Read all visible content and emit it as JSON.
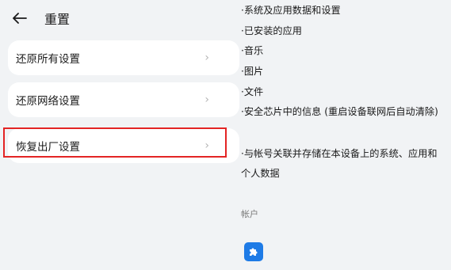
{
  "header": {
    "title": "重置"
  },
  "options": [
    {
      "label": "还原所有设置"
    },
    {
      "label": "还原网络设置"
    },
    {
      "label": "恢复出厂设置"
    }
  ],
  "reset_contents": [
    "·系统及应用数据和设置",
    "·已安装的应用",
    "·音乐",
    "·图片",
    "·文件",
    "·安全芯片中的信息 (重启设备联网后自动清除)",
    "·与帐号关联并存储在本设备上的系统、应用和个人数据"
  ],
  "accounts": {
    "heading": "帐户",
    "icon": "puzzle-icon"
  },
  "colors": {
    "highlight": "#e32424",
    "account_icon": "#1e7be6"
  }
}
